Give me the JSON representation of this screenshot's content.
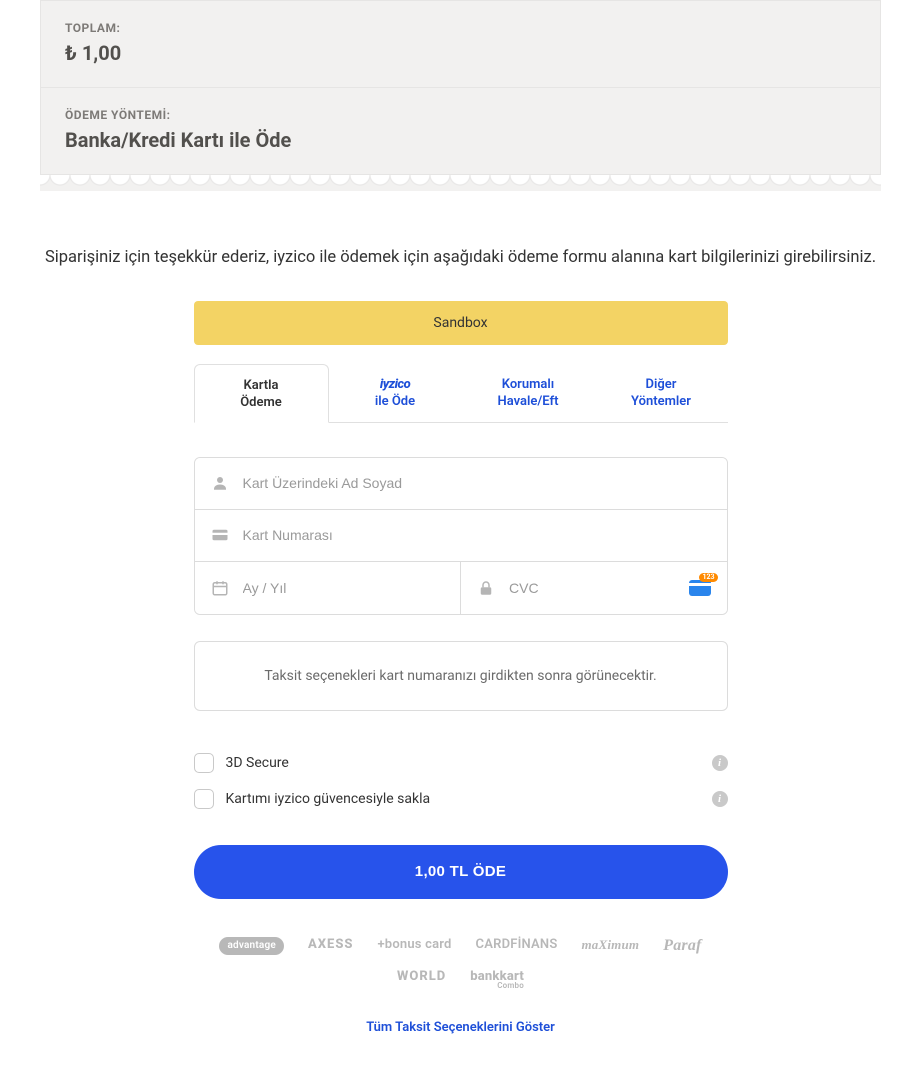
{
  "summary": {
    "total_label": "TOPLAM:",
    "total_value": "₺ 1,00",
    "method_label": "ÖDEME YÖNTEMİ:",
    "method_value": "Banka/Kredi Kartı ile Öde"
  },
  "thank_you": "Siparişiniz için teşekkür ederiz, iyzico ile ödemek için aşağıdaki ödeme formu alanına kart bilgilerinizi girebilirsiniz.",
  "sandbox_label": "Sandbox",
  "tabs": {
    "card": "Kartla\nÖdeme",
    "iyzico_brand": "iyzico",
    "iyzico_suffix": "ile Öde",
    "havale": "Korumalı\nHavale/Eft",
    "other": "Diğer\nYöntemler"
  },
  "fields": {
    "name_placeholder": "Kart Üzerindeki Ad Soyad",
    "number_placeholder": "Kart Numarası",
    "expiry_placeholder": "Ay / Yıl",
    "cvc_placeholder": "CVC"
  },
  "installment_hint": "Taksit seçenekleri kart numaranızı girdikten sonra görünecektir.",
  "checks": {
    "secure3d": "3D Secure",
    "save_card": "Kartımı iyzico güvencesiyle sakla"
  },
  "pay_button": "1,00 TL ÖDE",
  "logos": [
    "advantage",
    "AXESS",
    "+bonus card",
    "CARDFİNANS",
    "maXimum",
    "Paraf",
    "WORLD",
    "bankkart"
  ],
  "logos_sub": "Combo",
  "show_all": "Tüm Taksit Seçeneklerini Göster",
  "info_glyph": "i"
}
